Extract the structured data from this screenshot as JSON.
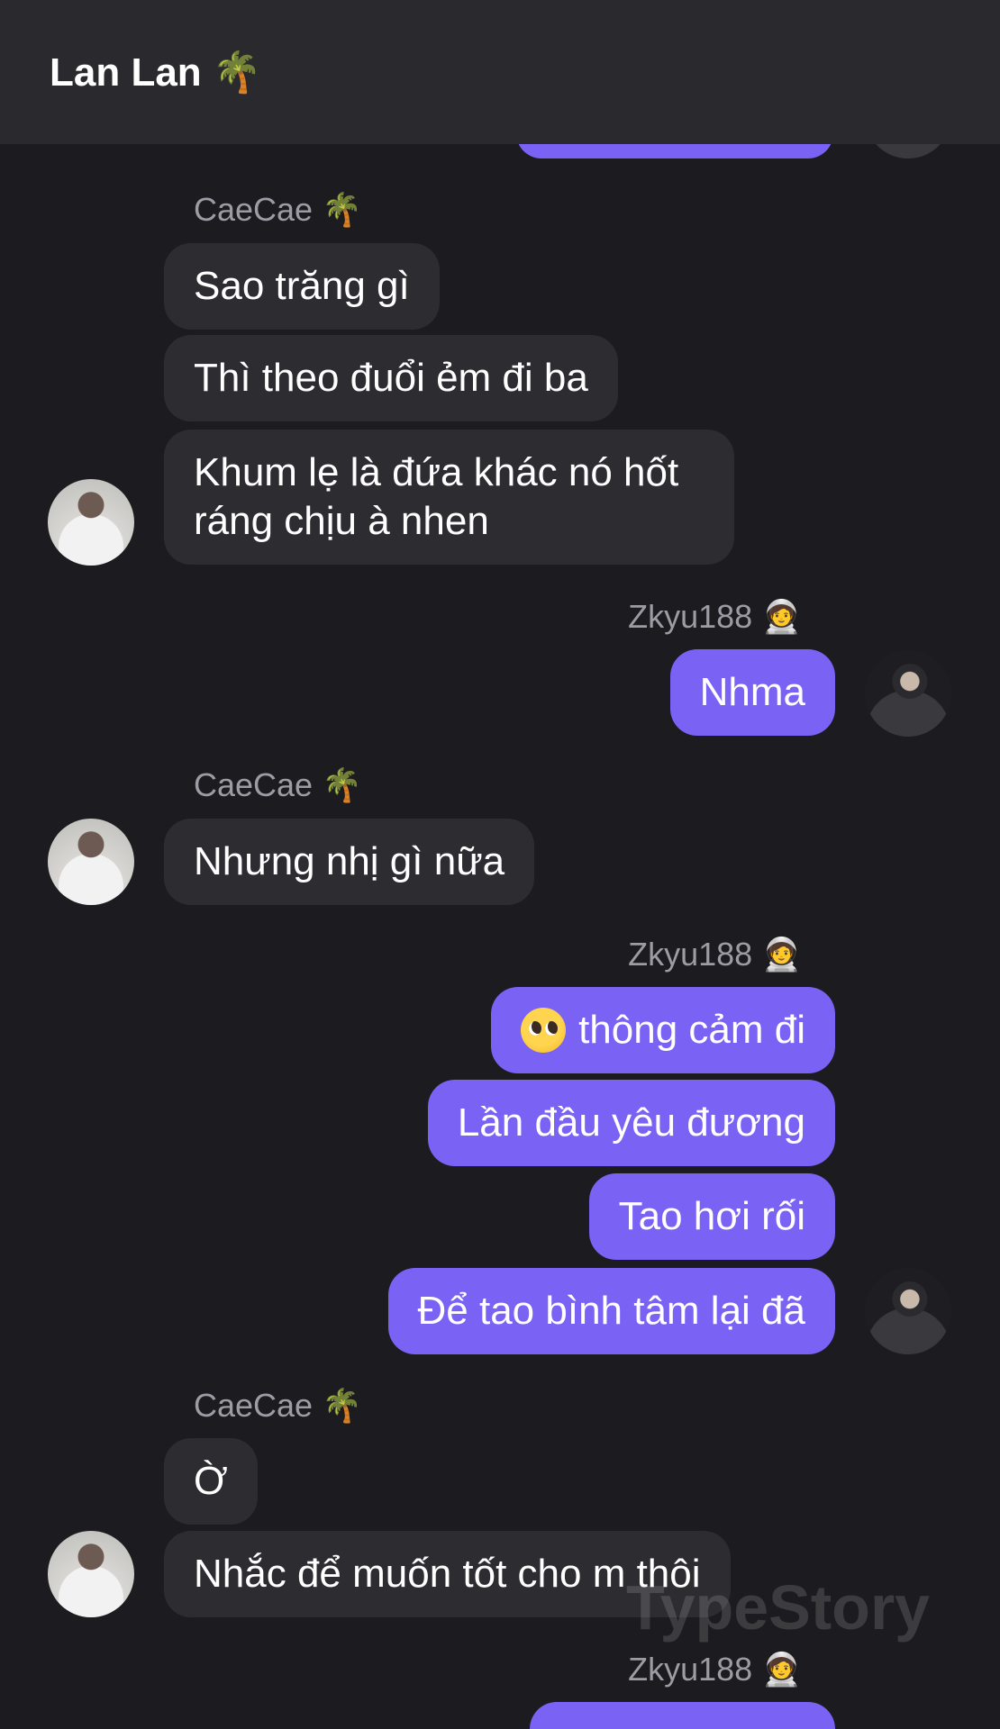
{
  "header": {
    "title": "Lan Lan 🌴"
  },
  "messages": {
    "g1_sender": "CaeCae 🌴",
    "g1_m1": "Sao trăng gì",
    "g1_m2": "Thì theo đuổi ẻm đi ba",
    "g1_m3": "Khum lẹ là đứa khác nó hốt ráng chịu à nhen",
    "g2_sender": "Zkyu188 🧑‍🚀",
    "g2_m1": "Nhma",
    "g3_sender": "CaeCae 🌴",
    "g3_m1": "Nhưng nhị gì nữa",
    "g4_sender": "Zkyu188 🧑‍🚀",
    "g4_m1": "thông cảm đi",
    "g4_m2": "Lần đầu yêu đương",
    "g4_m3": "Tao hơi rối",
    "g4_m4": "Để tao bình tâm lại đã",
    "g5_sender": "CaeCae 🌴",
    "g5_m1": "Ờ",
    "g5_m2": "Nhắc để muốn tốt cho m thôi",
    "g6_sender": "Zkyu188 🧑‍🚀"
  },
  "icons": {
    "emoji_pleading": "pleading-face-icon"
  },
  "watermark": "TypeStory",
  "colors": {
    "outgoing": "#7a62f5",
    "incoming": "#2d2c31",
    "background": "#1c1b1f"
  }
}
